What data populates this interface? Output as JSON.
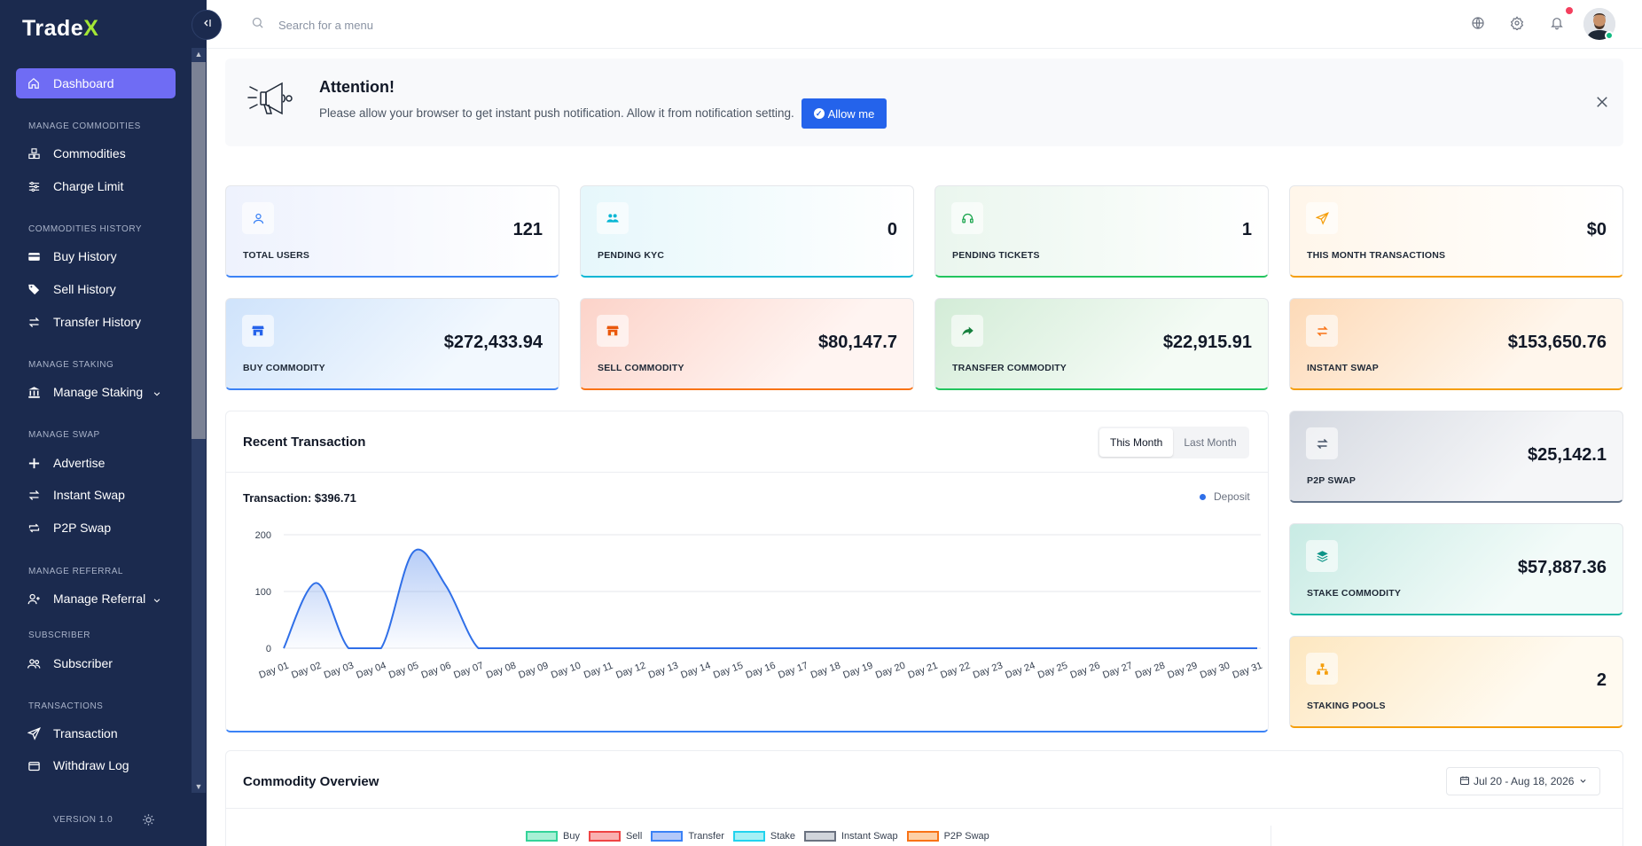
{
  "app": {
    "logo_text": "Trade",
    "logo_accent": "X"
  },
  "sidebar": {
    "dashboard": "Dashboard",
    "sections": {
      "manage_commodities": "MANAGE COMMODITIES",
      "commodities_history": "COMMODITIES HISTORY",
      "manage_staking": "MANAGE STAKING",
      "manage_swap": "MANAGE SWAP",
      "manage_referral": "MANAGE REFERRAL",
      "subscriber": "SUBSCRIBER",
      "transactions": "TRANSACTIONS"
    },
    "items": {
      "commodities": "Commodities",
      "charge_limit": "Charge Limit",
      "buy_history": "Buy History",
      "sell_history": "Sell History",
      "transfer_history": "Transfer History",
      "manage_staking": "Manage Staking",
      "advertise": "Advertise",
      "instant_swap": "Instant Swap",
      "p2p_swap": "P2P Swap",
      "manage_referral": "Manage Referral",
      "subscriber": "Subscriber",
      "transaction": "Transaction",
      "withdraw_log": "Withdraw Log"
    },
    "version": "VERSION 1.0",
    "accent_color": "#6f6cf4"
  },
  "topbar": {
    "search_placeholder": "Search for a menu"
  },
  "banner": {
    "title": "Attention!",
    "message": "Please allow your browser to get instant push notification. Allow it from notification setting.",
    "button": "Allow me"
  },
  "stats": {
    "total_users": {
      "label": "TOTAL USERS",
      "value": "121"
    },
    "pending_kyc": {
      "label": "PENDING KYC",
      "value": "0"
    },
    "pending_tickets": {
      "label": "PENDING TICKETS",
      "value": "1"
    },
    "month_transactions": {
      "label": "THIS MONTH TRANSACTIONS",
      "value": "$0"
    },
    "buy_commodity": {
      "label": "BUY COMMODITY",
      "value": "$272,433.94"
    },
    "sell_commodity": {
      "label": "SELL COMMODITY",
      "value": "$80,147.7"
    },
    "transfer_commodity": {
      "label": "TRANSFER COMMODITY",
      "value": "$22,915.91"
    },
    "instant_swap": {
      "label": "INSTANT SWAP",
      "value": "$153,650.76"
    },
    "p2p_swap": {
      "label": "P2P SWAP",
      "value": "$25,142.1"
    },
    "stake_commodity": {
      "label": "STAKE COMMODITY",
      "value": "$57,887.36"
    },
    "staking_pools": {
      "label": "STAKING POOLS",
      "value": "2"
    }
  },
  "recent": {
    "title": "Recent Transaction",
    "tabs": [
      "This Month",
      "Last Month"
    ],
    "active_tab": "This Month",
    "subtitle": "Transaction: $396.71",
    "legend": "Deposit"
  },
  "chart_data": {
    "type": "area",
    "title": "",
    "xlabel": "",
    "ylabel": "",
    "categories": [
      "Day 01",
      "Day 02",
      "Day 03",
      "Day 04",
      "Day 05",
      "Day 06",
      "Day 07",
      "Day 08",
      "Day 09",
      "Day 10",
      "Day 11",
      "Day 12",
      "Day 13",
      "Day 14",
      "Day 15",
      "Day 16",
      "Day 17",
      "Day 18",
      "Day 19",
      "Day 20",
      "Day 21",
      "Day 22",
      "Day 23",
      "Day 24",
      "Day 25",
      "Day 26",
      "Day 27",
      "Day 28",
      "Day 29",
      "Day 30",
      "Day 31"
    ],
    "series": [
      {
        "name": "Deposit",
        "color": "#2f6fe8",
        "values": [
          0,
          115,
          0,
          0,
          170,
          110,
          0,
          0,
          0,
          0,
          0,
          0,
          0,
          0,
          0,
          0,
          0,
          0,
          0,
          0,
          0,
          0,
          0,
          0,
          0,
          0,
          0,
          0,
          0,
          0,
          0
        ]
      }
    ],
    "yticks": [
      0,
      100,
      200
    ],
    "ylim": [
      0,
      200
    ],
    "grid": true,
    "legend": "top-right"
  },
  "overview": {
    "title": "Commodity Overview",
    "date_range": "Jul 20 - Aug 18, 2026",
    "legend": [
      {
        "label": "Buy",
        "fill": "#a7f0d5",
        "stroke": "#34d399"
      },
      {
        "label": "Sell",
        "fill": "#f9b0b0",
        "stroke": "#ef4444"
      },
      {
        "label": "Transfer",
        "fill": "#b3c8f9",
        "stroke": "#3b82f6"
      },
      {
        "label": "Stake",
        "fill": "#a5f0f5",
        "stroke": "#22d3ee"
      },
      {
        "label": "Instant Swap",
        "fill": "#d1d5db",
        "stroke": "#6b7280"
      },
      {
        "label": "P2P Swap",
        "fill": "#fdd0a6",
        "stroke": "#f97316"
      }
    ]
  }
}
